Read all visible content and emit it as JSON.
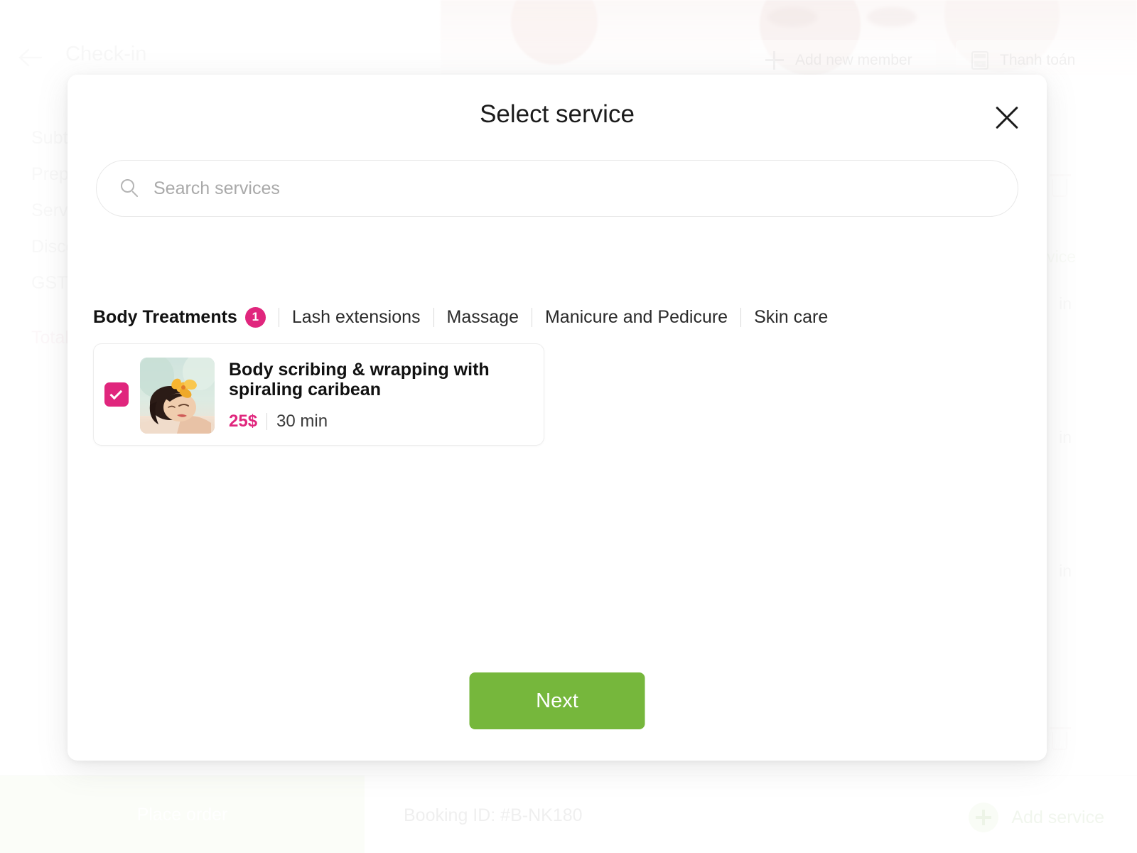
{
  "background": {
    "page_title": "Check-in",
    "back_icon": "arrow-left-icon",
    "header_buttons": [
      {
        "label": "Add new member",
        "icon": "plus-icon"
      },
      {
        "label": "Thanh toán",
        "icon": "calculator-icon"
      }
    ],
    "summary_rows": [
      "Subtotal",
      "Prepaid",
      "Service",
      "Discount",
      "GST"
    ],
    "summary_total": "Total",
    "right_column_items": [
      "Add service",
      "in",
      "in",
      "in"
    ],
    "bottom_bar": {
      "place_order_label": "Place order",
      "booking_id": "Booking ID: #B-NK180",
      "add_service_label": "Add service"
    }
  },
  "modal": {
    "title": "Select service",
    "close_icon": "close-icon",
    "search": {
      "icon": "search-icon",
      "value": "",
      "placeholder": "Search services"
    },
    "tabs": [
      {
        "label": "Body Treatments",
        "badge": "1",
        "active": true
      },
      {
        "label": "Lash extensions",
        "badge": "",
        "active": false
      },
      {
        "label": "Massage",
        "badge": "",
        "active": false
      },
      {
        "label": "Manicure and Pedicure",
        "badge": "",
        "active": false
      },
      {
        "label": "Skin care",
        "badge": "",
        "active": false
      }
    ],
    "services": [
      {
        "name": "Body scribing & wrapping with spiraling caribean",
        "price": "25$",
        "duration": "30 min",
        "selected": true,
        "thumbnail": "spa-woman-flower-image",
        "checkbox_icon": "check-icon"
      }
    ],
    "next_label": "Next"
  },
  "colors": {
    "accent_pink": "#e0267d",
    "accent_green": "#76b73c",
    "text_dark": "#111111",
    "placeholder_grey": "#a9a9a9"
  }
}
